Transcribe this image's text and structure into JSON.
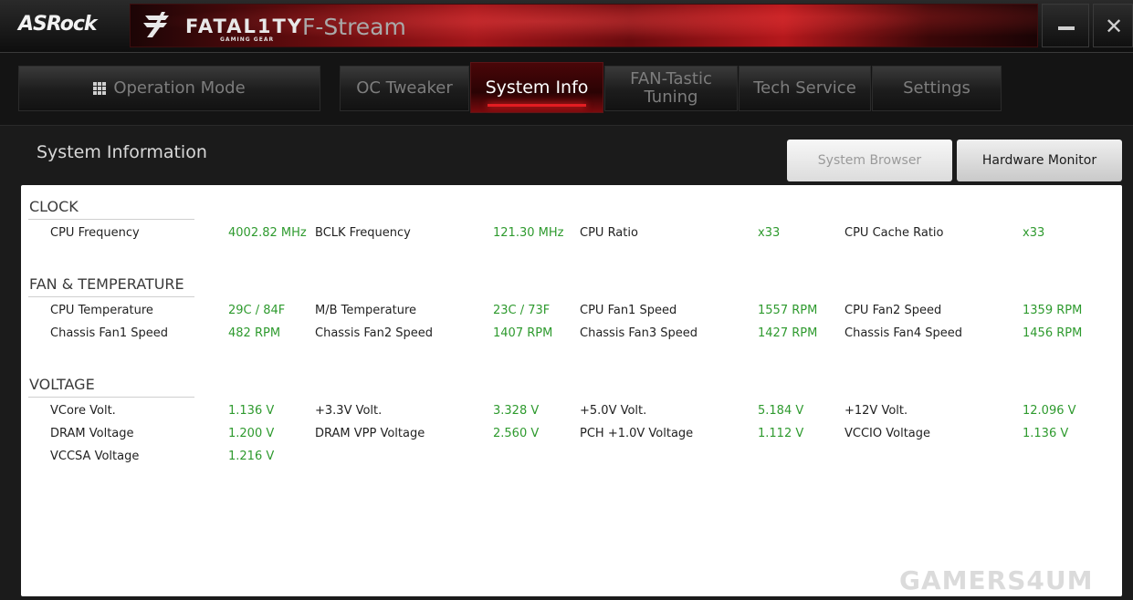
{
  "titlebar": {
    "logo": "ASRock",
    "brand": "FATAL1TY",
    "brand_sub": "GAMING GEAR",
    "app_name": "F-Stream",
    "minimize_icon": "minimize-icon",
    "close_icon": "close-icon",
    "close_glyph": "✕"
  },
  "nav": {
    "operation_mode": "Operation Mode",
    "oc_tweaker": "OC Tweaker",
    "system_info": "System Info",
    "fan_tuning_line1": "FAN-Tastic",
    "fan_tuning_line2": "Tuning",
    "tech_service": "Tech Service",
    "settings": "Settings",
    "active_tab": "System Info"
  },
  "header": {
    "title": "System Information",
    "system_browser": "System Browser",
    "hardware_monitor": "Hardware Monitor"
  },
  "clock": {
    "title": "CLOCK",
    "rows": [
      [
        {
          "label": "CPU Frequency",
          "value": "4002.82 MHz"
        },
        {
          "label": "BCLK Frequency",
          "value": "121.30 MHz"
        },
        {
          "label": "CPU Ratio",
          "value": "x33"
        },
        {
          "label": "CPU Cache Ratio",
          "value": "x33"
        }
      ]
    ]
  },
  "fan_temp": {
    "title": "FAN & TEMPERATURE",
    "rows": [
      [
        {
          "label": "CPU Temperature",
          "value": "29C / 84F"
        },
        {
          "label": "M/B Temperature",
          "value": "23C / 73F"
        },
        {
          "label": "CPU Fan1 Speed",
          "value": "1557 RPM"
        },
        {
          "label": "CPU Fan2 Speed",
          "value": "1359 RPM"
        }
      ],
      [
        {
          "label": "Chassis Fan1 Speed",
          "value": "482 RPM"
        },
        {
          "label": "Chassis Fan2 Speed",
          "value": "1407 RPM"
        },
        {
          "label": "Chassis Fan3 Speed",
          "value": "1427 RPM"
        },
        {
          "label": "Chassis Fan4 Speed",
          "value": "1456 RPM"
        }
      ]
    ]
  },
  "voltage": {
    "title": "VOLTAGE",
    "rows": [
      [
        {
          "label": "VCore Volt.",
          "value": "1.136 V"
        },
        {
          "label": "+3.3V Volt.",
          "value": "3.328 V"
        },
        {
          "label": "+5.0V Volt.",
          "value": "5.184 V"
        },
        {
          "label": "+12V Volt.",
          "value": "12.096 V"
        }
      ],
      [
        {
          "label": "DRAM Voltage",
          "value": "1.200 V"
        },
        {
          "label": "DRAM VPP Voltage",
          "value": "2.560 V"
        },
        {
          "label": "PCH +1.0V Voltage",
          "value": "1.112 V"
        },
        {
          "label": "VCCIO Voltage",
          "value": "1.136 V"
        }
      ],
      [
        {
          "label": "VCCSA Voltage",
          "value": "1.216 V"
        }
      ]
    ]
  },
  "watermark": "GAMERS4UM",
  "colors": {
    "accent_red": "#e21d22",
    "value_green": "#2e9a2e"
  }
}
